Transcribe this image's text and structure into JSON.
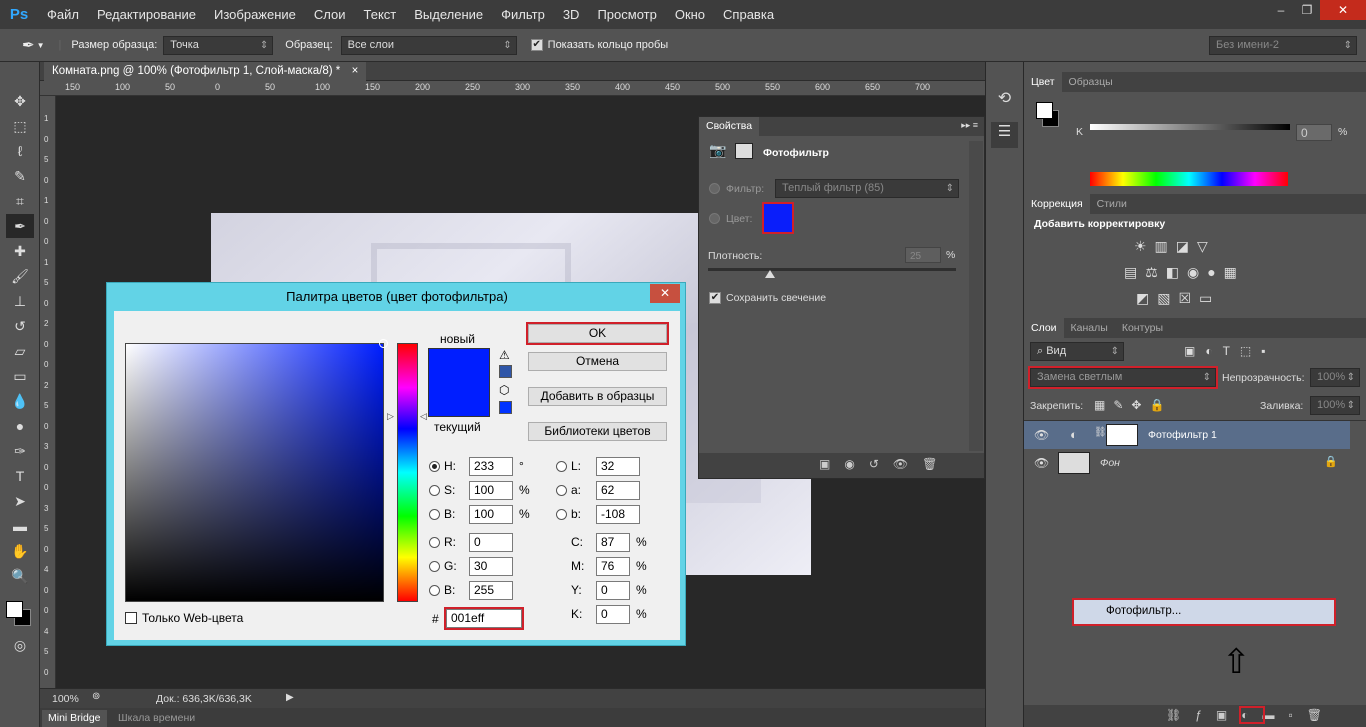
{
  "app": {
    "logo": "Ps"
  },
  "menu": [
    "Файл",
    "Редактирование",
    "Изображение",
    "Слои",
    "Текст",
    "Выделение",
    "Фильтр",
    "3D",
    "Просмотр",
    "Окно",
    "Справка"
  ],
  "options": {
    "sample_size_label": "Размер образца:",
    "sample_size_value": "Точка",
    "sample_label": "Образец:",
    "sample_value": "Все слои",
    "show_ring_label": "Показать кольцо пробы",
    "workspace_value": "Без имени-2"
  },
  "document": {
    "tab_title": "Комната.png @ 100% (Фотофильтр 1, Слой-маска/8) *",
    "ruler_top": [
      "150",
      "100",
      "50",
      "0",
      "50",
      "100",
      "150",
      "200",
      "250",
      "300",
      "350",
      "400",
      "450",
      "500",
      "550",
      "600",
      "650",
      "700"
    ],
    "ruler_left": [
      "1",
      "0",
      "5",
      "0",
      "1",
      "0",
      "0",
      "1",
      "5",
      "0",
      "2",
      "0",
      "0",
      "2",
      "5",
      "0",
      "3",
      "0",
      "0",
      "3",
      "5",
      "0",
      "4",
      "0",
      "0",
      "4",
      "5",
      "0"
    ]
  },
  "status": {
    "zoom": "100%",
    "doc_info": "Док.: 636,3K/636,3K"
  },
  "bottom_tabs": [
    "Mini Bridge",
    "Шкала времени"
  ],
  "properties": {
    "tab": "Свойства",
    "title": "Фотофильтр",
    "filter_label": "Фильтр:",
    "filter_value": "Теплый фильтр (85)",
    "color_label": "Цвет:",
    "color_swatch": "#0a1efa",
    "density_label": "Плотность:",
    "density_value": "25",
    "density_unit": "%",
    "density_level": 0.25,
    "preserve_label": "Сохранить свечение"
  },
  "picker": {
    "title": "Палитра цветов (цвет фотофильтра)",
    "new_label": "новый",
    "current_label": "текущий",
    "ok": "OK",
    "cancel": "Отмена",
    "add_swatches": "Добавить в образцы",
    "libraries": "Библиотеки цветов",
    "web_only": "Только Web-цвета",
    "hue_color": "#001eff",
    "hsb": [
      {
        "l": "H:",
        "v": "233",
        "u": "°"
      },
      {
        "l": "S:",
        "v": "100",
        "u": "%"
      },
      {
        "l": "B:",
        "v": "100",
        "u": "%"
      }
    ],
    "rgb": [
      {
        "l": "R:",
        "v": "0"
      },
      {
        "l": "G:",
        "v": "30"
      },
      {
        "l": "B:",
        "v": "255"
      }
    ],
    "lab": [
      {
        "l": "L:",
        "v": "32"
      },
      {
        "l": "a:",
        "v": "62"
      },
      {
        "l": "b:",
        "v": "-108"
      }
    ],
    "cmyk": [
      {
        "l": "C:",
        "v": "87",
        "u": "%"
      },
      {
        "l": "M:",
        "v": "76",
        "u": "%"
      },
      {
        "l": "Y:",
        "v": "0",
        "u": "%"
      },
      {
        "l": "K:",
        "v": "0",
        "u": "%"
      }
    ],
    "hex_label": "#",
    "hex": "001eff"
  },
  "color_panel": {
    "tabs": [
      "Цвет",
      "Образцы"
    ],
    "k_label": "K",
    "k_value": "0",
    "k_unit": "%"
  },
  "adjust_panel": {
    "tabs": [
      "Коррекция",
      "Стили"
    ],
    "title": "Добавить корректировку"
  },
  "layers_panel": {
    "tabs": [
      "Слои",
      "Каналы",
      "Контуры"
    ],
    "kind": "Вид",
    "blend": "Замена светлым",
    "opacity_label": "Непрозрачность:",
    "opacity_value": "100%",
    "lock_label": "Закрепить:",
    "fill_label": "Заливка:",
    "fill_value": "100%",
    "layers": [
      {
        "name": "Фотофильтр 1"
      },
      {
        "name": "Фон"
      }
    ],
    "context_item": "Фотофильтр..."
  }
}
